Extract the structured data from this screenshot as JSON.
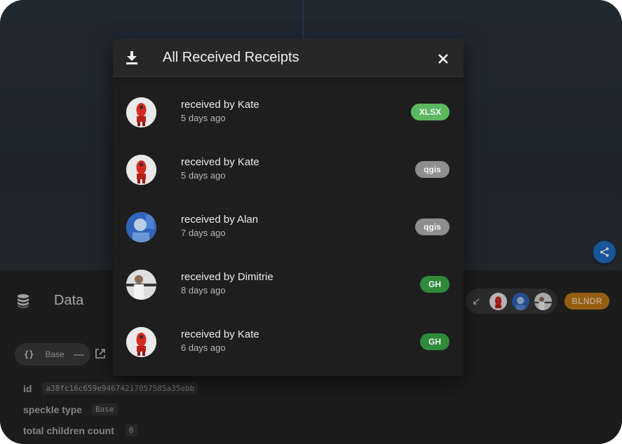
{
  "dialog": {
    "title": "All Received Receipts",
    "receipts": [
      {
        "who": "received by Kate",
        "when": "5 days ago",
        "source": "XLSX",
        "source_color": "#5cb860",
        "avatar": "red-robot"
      },
      {
        "who": "received by Kate",
        "when": "5 days ago",
        "source": "qgis",
        "source_color": "#8e8e8e",
        "avatar": "red-robot"
      },
      {
        "who": "received by Alan",
        "when": "7 days ago",
        "source": "qgis",
        "source_color": "#8e8e8e",
        "avatar": "photo-alan"
      },
      {
        "who": "received by Dimitrie",
        "when": "8 days ago",
        "source": "GH",
        "source_color": "#2f8a3a",
        "avatar": "photo-dimitrie"
      },
      {
        "who": "received by Kate",
        "when": "6 days ago",
        "source": "GH",
        "source_color": "#2f8a3a",
        "avatar": "red-robot"
      }
    ]
  },
  "panel": {
    "title": "Data",
    "app_badge": "BLNDR",
    "base_chip": {
      "braces": "{}",
      "label": "Base",
      "collapse": "—"
    },
    "properties": [
      {
        "key": "id",
        "value": "a38fc16c659e94674217057585a35ebb"
      },
      {
        "key": "speckle type",
        "value": "Base"
      },
      {
        "key": "total children count",
        "value": "0"
      }
    ]
  },
  "colors": {
    "accent": "#1f6fc4",
    "blndr": "#bf7a19",
    "dialog_bg": "#1e1e1e"
  }
}
